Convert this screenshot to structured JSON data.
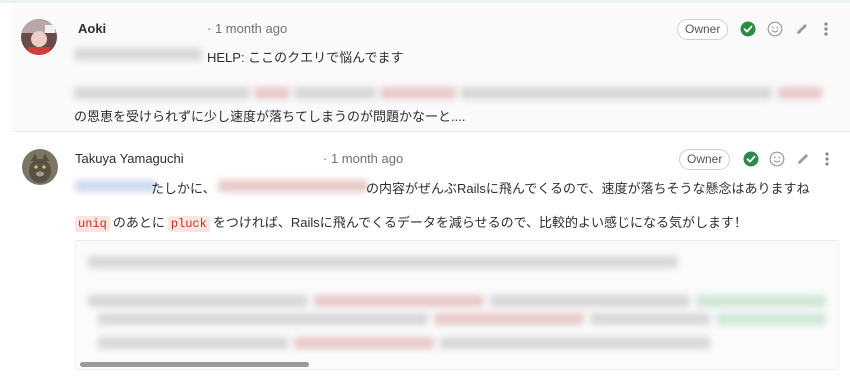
{
  "notes": [
    {
      "author": "Aoki",
      "time": "· 1 month ago",
      "badge": "Owner",
      "line1": "HELP: ここのクエリで悩んでます",
      "line2": "の恩恵を受けられずに少し速度が落ちてしまうのが問題かなーと....",
      "avatar_icon": "user-avatar-photo"
    },
    {
      "author": "Takuya Yamaguchi",
      "time": "· 1 month ago",
      "badge": "Owner",
      "line1_a": "たしかに、",
      "line1_b": "の内容がぜんぶRailsに飛んでくるので、速度が落ちそうな懸念はありますね",
      "code1": "uniq",
      "line2_a": "のあとに",
      "code2": "pluck",
      "line2_b": "をつければ、Railsに飛んでくるデータを減らせるので、比較的よい感じになる気がします！",
      "avatar_icon": "cat-avatar-photo"
    }
  ],
  "colors": {
    "resolved": "#2e8b47",
    "code_text": "#c0341d",
    "code_bg": "#fbe5e1"
  },
  "icons": [
    "resolved-check-icon",
    "emoji-icon",
    "edit-pencil-icon",
    "more-options-icon"
  ]
}
